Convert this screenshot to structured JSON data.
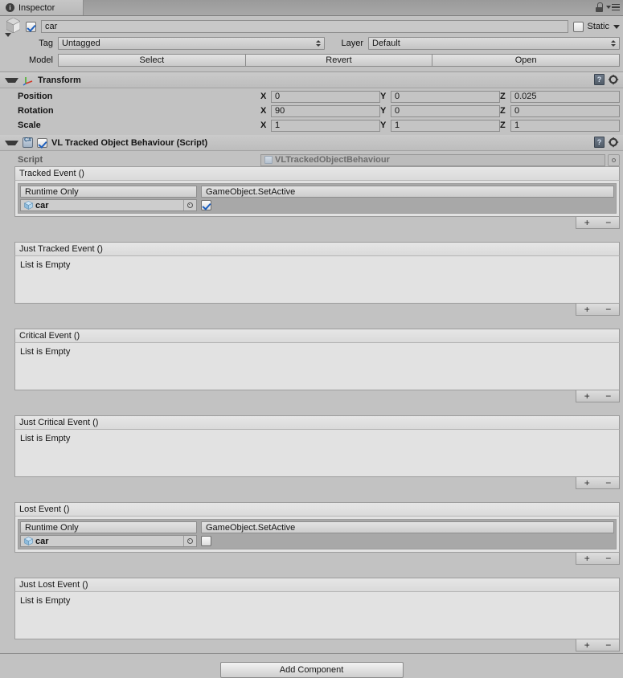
{
  "window": {
    "tab_label": "Inspector",
    "tab_icon": "info-icon",
    "lock_icon": "lock-icon",
    "menu_icon": "hamburger-menu-icon"
  },
  "gameobject": {
    "enabled": true,
    "name_value": "car",
    "static_label": "Static",
    "static_checked": false,
    "tag_label": "Tag",
    "tag_value": "Untagged",
    "layer_label": "Layer",
    "layer_value": "Default",
    "model_label": "Model",
    "model_buttons": [
      "Select",
      "Revert",
      "Open"
    ]
  },
  "transform": {
    "title": "Transform",
    "rows": [
      {
        "name": "Position",
        "x": "0",
        "y": "0",
        "z": "0.025"
      },
      {
        "name": "Rotation",
        "x": "90",
        "y": "0",
        "z": "0"
      },
      {
        "name": "Scale",
        "x": "1",
        "y": "1",
        "z": "1"
      }
    ],
    "axis_labels": {
      "x": "X",
      "y": "Y",
      "z": "Z"
    }
  },
  "script_component": {
    "title": "VL Tracked Object Behaviour (Script)",
    "enabled": true,
    "script_label": "Script",
    "script_value": "VLTrackedObjectBehaviour"
  },
  "events": [
    {
      "title": "Tracked Event ()",
      "empty": false,
      "empty_text": "",
      "call": {
        "mode": "Runtime Only",
        "function": "GameObject.SetActive",
        "target": "car",
        "arg_checked": true
      }
    },
    {
      "title": "Just Tracked Event ()",
      "empty": true,
      "empty_text": "List is Empty"
    },
    {
      "title": "Critical Event ()",
      "empty": true,
      "empty_text": "List is Empty"
    },
    {
      "title": "Just Critical Event ()",
      "empty": true,
      "empty_text": "List is Empty"
    },
    {
      "title": "Lost Event ()",
      "empty": false,
      "empty_text": "",
      "call": {
        "mode": "Runtime Only",
        "function": "GameObject.SetActive",
        "target": "car",
        "arg_checked": false
      }
    },
    {
      "title": "Just Lost Event ()",
      "empty": true,
      "empty_text": "List is Empty"
    }
  ],
  "list_buttons": {
    "add": "+",
    "remove": "−"
  },
  "footer": {
    "add_component_label": "Add Component"
  },
  "colors": {
    "window_bg": "#c2c2c2",
    "tab_bg": "#a3a3a3",
    "event_body_bg": "#e2e2e2",
    "call_row_bg": "#a8a8a8",
    "checkbox_check": "#1d5fbd"
  }
}
